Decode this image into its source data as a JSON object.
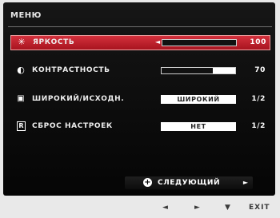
{
  "menu": {
    "title": "МЕНЮ",
    "items": [
      {
        "icon": "brightness-icon",
        "glyph": "✳",
        "label": "ЯРКОСТЬ",
        "value": "100",
        "level": 100,
        "selected": true
      },
      {
        "icon": "contrast-icon",
        "glyph": "◐",
        "label": "КОНТРАСТНОСТЬ",
        "value": "70",
        "level": 70
      },
      {
        "icon": "aspect-ratio-icon",
        "glyph": "▣",
        "label": "ШИРОКИЙ/ИСХОДН.",
        "option": "ШИРОКИЙ",
        "value": "1/2"
      },
      {
        "icon": "reset-icon",
        "glyph": "R",
        "label": "СБРОС НАСТРОЕК",
        "option": "НЕТ",
        "value": "1/2"
      }
    ],
    "next_label": "СЛЕДУЮЩИЙ"
  },
  "footer": {
    "left_arrow": "◄",
    "right_arrow": "►",
    "down_arrow": "▼",
    "exit": "EXIT"
  },
  "colors": {
    "selected_row": "#c42330",
    "panel_bg": "#0d0d0d",
    "frame_bg": "#e9e9e9"
  }
}
